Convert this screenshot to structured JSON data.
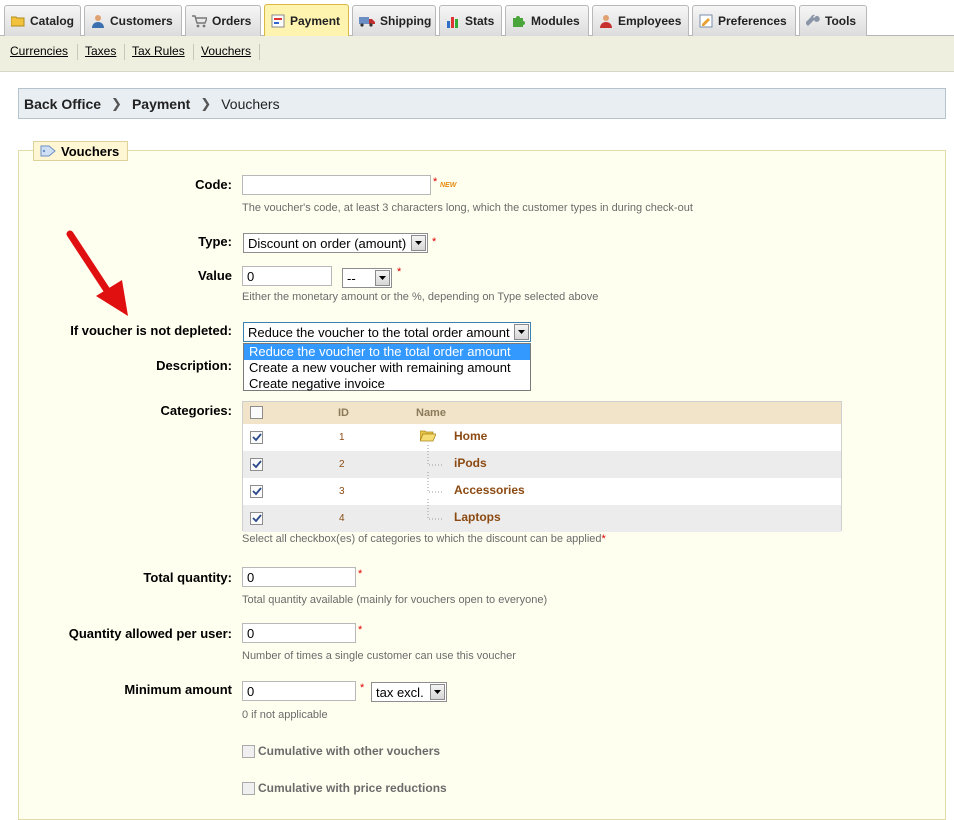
{
  "tabs": [
    {
      "label": "Catalog",
      "icon": "folder-icon"
    },
    {
      "label": "Customers",
      "icon": "user-icon"
    },
    {
      "label": "Orders",
      "icon": "cart-icon"
    },
    {
      "label": "Payment",
      "icon": "payment-icon",
      "active": true
    },
    {
      "label": "Shipping",
      "icon": "truck-icon"
    },
    {
      "label": "Stats",
      "icon": "chart-icon"
    },
    {
      "label": "Modules",
      "icon": "puzzle-icon"
    },
    {
      "label": "Employees",
      "icon": "employee-icon"
    },
    {
      "label": "Preferences",
      "icon": "preferences-icon"
    },
    {
      "label": "Tools",
      "icon": "wrench-icon"
    }
  ],
  "subnav": [
    "Currencies",
    "Taxes",
    "Tax Rules",
    "Vouchers"
  ],
  "breadcrumb": [
    "Back Office",
    "Payment",
    "Vouchers"
  ],
  "section_title": "Vouchers",
  "form": {
    "code": {
      "label": "Code:",
      "value": "",
      "badge": "NEW",
      "hint": "The voucher's code, at least 3 characters long, which the customer types in during check-out"
    },
    "type": {
      "label": "Type:",
      "selected": "Discount on order (amount)"
    },
    "value": {
      "label": "Value",
      "value": "0",
      "unit_selected": "--",
      "hint": "Either the monetary amount or the %, depending on Type selected above"
    },
    "not_depleted": {
      "label": "If voucher is not depleted:",
      "selected": "Reduce the voucher to the total order amount",
      "options": [
        "Reduce the voucher to the total order amount",
        "Create a new voucher with remaining amount",
        "Create negative invoice"
      ]
    },
    "description": {
      "label": "Description:"
    },
    "categories": {
      "label": "Categories:",
      "col_id": "ID",
      "col_name": "Name",
      "rows": [
        {
          "id": "1",
          "name": "Home",
          "checked": true
        },
        {
          "id": "2",
          "name": "iPods",
          "checked": true
        },
        {
          "id": "3",
          "name": "Accessories",
          "checked": true
        },
        {
          "id": "4",
          "name": "Laptops",
          "checked": true
        }
      ],
      "hint": "Select all checkbox(es) of categories to which the discount can be applied"
    },
    "total_quantity": {
      "label": "Total quantity:",
      "value": "0",
      "hint": "Total quantity available (mainly for vouchers open to everyone)"
    },
    "qty_per_user": {
      "label": "Quantity allowed per user:",
      "value": "0",
      "hint": "Number of times a single customer can use this voucher"
    },
    "min_amount": {
      "label": "Minimum amount",
      "value": "0",
      "tax_selected": "tax excl.",
      "hint": "0 if not applicable"
    },
    "cumulative_vouchers": {
      "label": "Cumulative with other vouchers",
      "checked": false
    },
    "cumulative_reductions": {
      "label": "Cumulative with price reductions",
      "checked": false
    }
  },
  "required_mark": "*",
  "colors": {
    "active_tab": "#fff3b0",
    "subnav_bg": "#efefe0",
    "fieldset_bg": "#fffff0",
    "highlight": "#3399ff",
    "table_header": "#f2e4c8",
    "link_brown": "#8c4a12",
    "required": "#dd0000",
    "annotation_arrow": "#e01010"
  }
}
